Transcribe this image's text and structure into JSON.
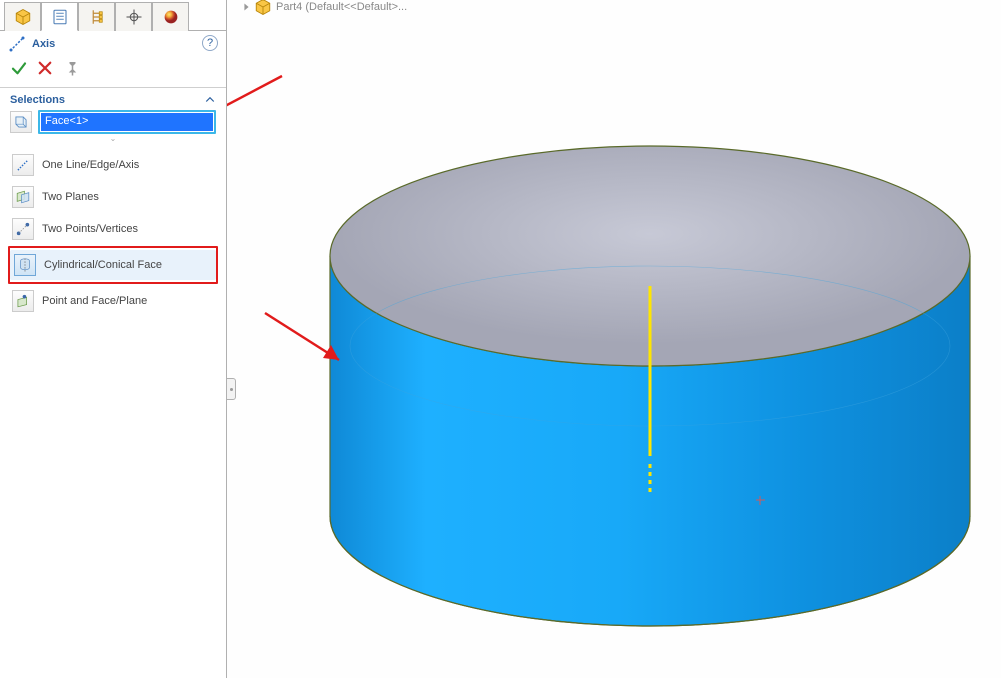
{
  "tree": {
    "part_label": "Part4 (Default<<Default>..."
  },
  "feature": {
    "title": "Axis",
    "help_glyph": "?"
  },
  "section": {
    "selections_label": "Selections",
    "selected_item": "Face<1>"
  },
  "methods": {
    "one_line": "One Line/Edge/Axis",
    "two_planes": "Two Planes",
    "two_points": "Two Points/Vertices",
    "cylindrical": "Cylindrical/Conical Face",
    "point_face": "Point and Face/Plane"
  },
  "icons": {
    "feature_mgr": "feature-manager",
    "property_mgr": "property-manager",
    "config_mgr": "config-manager",
    "dim_mgr": "dimxpert",
    "appearance_mgr": "appearance"
  }
}
